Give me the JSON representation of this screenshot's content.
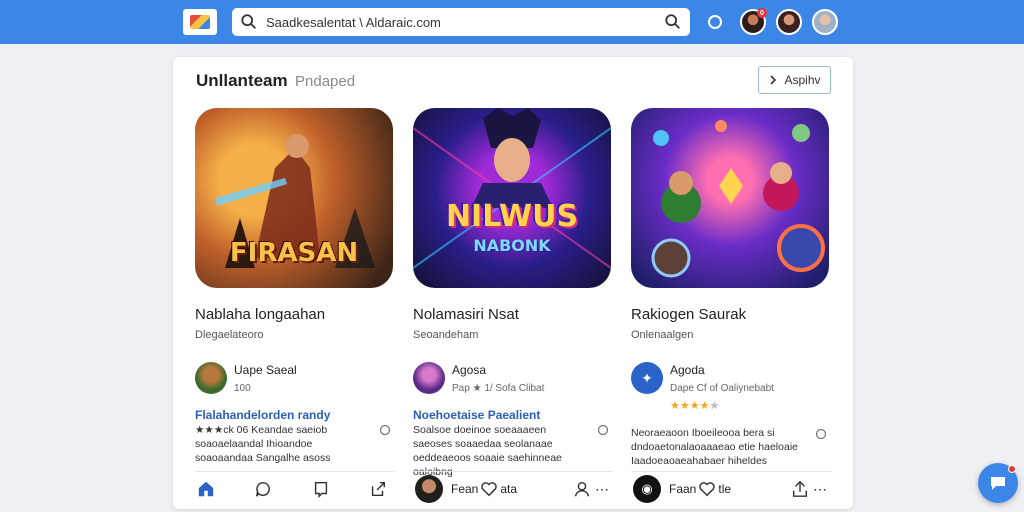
{
  "topbar": {
    "search_value": "Saadkesalentat \\ Aldaraic.com",
    "notif_count": "0"
  },
  "header": {
    "title": "Unllanteam",
    "subtitle": "Pndaped",
    "button_label": "Aspihv"
  },
  "games": [
    {
      "art_title": "FIRASAN",
      "name": "Nablaha longaahan",
      "category": "Dlegaelateoro",
      "dev_name": "Uape Saeal",
      "dev_meta": "100",
      "review_title": "Flalahandelorden randy",
      "review_body": "★★★ck 06 Keandae saeiob soaoaelaandal Ihioandoe soaoaandaa Sangalhe asoss",
      "action_label": ""
    },
    {
      "art_title": "NILWUS",
      "art_subtitle": "NABONK",
      "name": "Nolamasiri Nsat",
      "category": "Seoandeham",
      "dev_name": "Agosa",
      "dev_meta": "Pap ★ 1/ Sofa Clibat",
      "review_title": "Noehoetaise Paealient",
      "review_body": "Soalsoe doeinoe soeaaaeen saeoses soaaedaa seolanaae oeddeaeoos soaaie saehinneae oaloibng",
      "action_label": "Fean"
    },
    {
      "art_title": "",
      "name": "Rakiogen Saurak",
      "category": "Onlenaalgen",
      "dev_name": "Agoda",
      "dev_meta": "Dape Cf of Oaliynebabt",
      "rating": 4,
      "review_title": "",
      "review_body": "Neoraeaoon Iboeileooa bera si dndoaetonalaoaaaeao etie haeloaie Iaadoeaoaeahabaer hiheldes",
      "action_label": "Faan"
    }
  ],
  "icons": [
    "search-icon",
    "bell-icon",
    "home-icon",
    "comment-icon",
    "bookmark-icon",
    "share-icon",
    "heart-icon",
    "user-icon",
    "more-icon",
    "chat-icon"
  ],
  "colors": {
    "accent": "#3b86e6",
    "link": "#2c5fb8",
    "star": "#f2a81d",
    "badge": "#e53935"
  }
}
